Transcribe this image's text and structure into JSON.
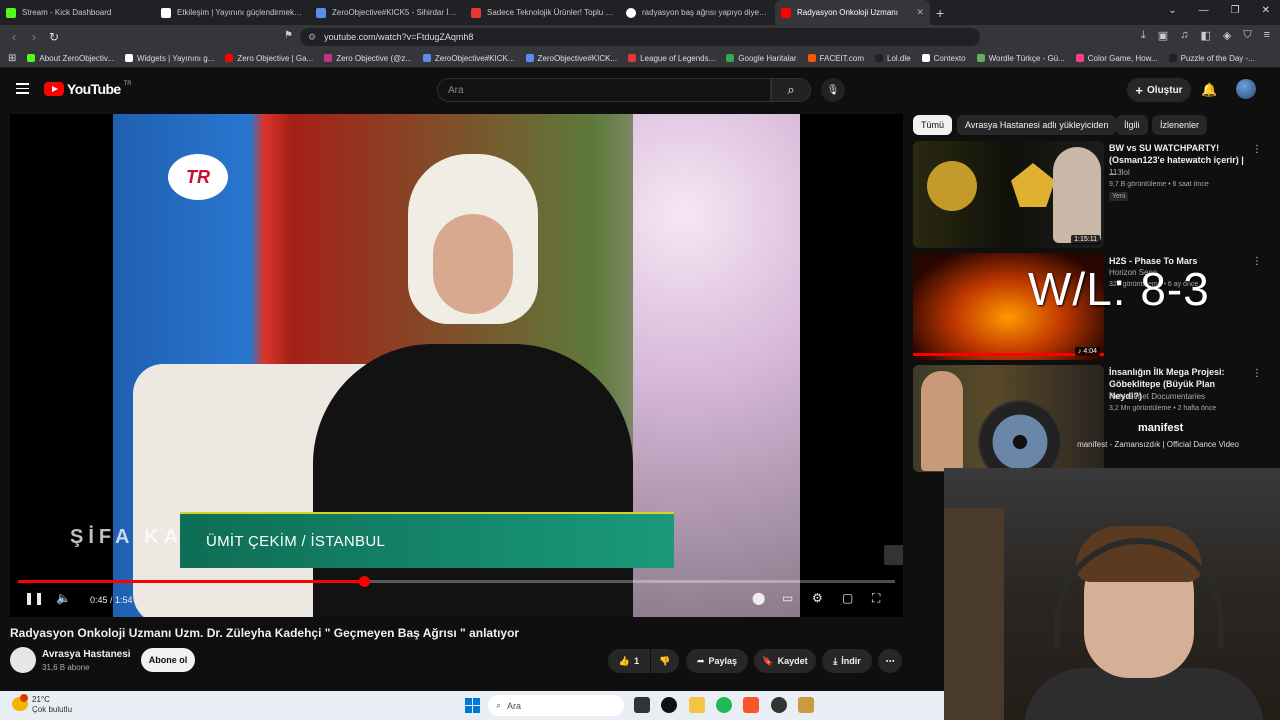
{
  "browser": {
    "tabs": [
      {
        "label": "Stream - Kick Dashboard",
        "color": "#53fc18"
      },
      {
        "label": "Etkileşim | Yayınını güçlendirmek için",
        "color": "#ffffff"
      },
      {
        "label": "ZeroObjective#KICK5 - Sihirdar İstatis",
        "color": "#5a8dee"
      },
      {
        "label": "Sadece Teknolojik Ürünler! Toplu Paket",
        "color": "#e53935"
      },
      {
        "label": "radyasyon baş ağrısı yapıyo diyen uz",
        "color": "#ffffff"
      },
      {
        "label": "Radyasyon Onkoloji Uzmanı",
        "color": "#ff0000"
      }
    ],
    "url": "youtube.com/watch?v=FtdugZAqmh8",
    "bookmarks": [
      {
        "label": "About ZeroObjectiv...",
        "color": "#53fc18"
      },
      {
        "label": "Widgets | Yayınını g...",
        "color": "#ffffff"
      },
      {
        "label": "Zero Objective | Ga...",
        "color": "#ff0000"
      },
      {
        "label": "Zero Objective (@z...",
        "color": "#c13584"
      },
      {
        "label": "ZeroObjective#KICK...",
        "color": "#5a8dee"
      },
      {
        "label": "ZeroObjective#KICK...",
        "color": "#5a8dee"
      },
      {
        "label": "League of Legends...",
        "color": "#e53935"
      },
      {
        "label": "Google Haritalar",
        "color": "#34a853"
      },
      {
        "label": "FACEIT.com",
        "color": "#ff5500"
      },
      {
        "label": "Lol.dle",
        "color": "#222222"
      },
      {
        "label": "Contexto",
        "color": "#ffffff"
      },
      {
        "label": "Wordle Türkçe - Gü...",
        "color": "#6aaa64"
      },
      {
        "label": "Color Game, How...",
        "color": "#ff4081"
      },
      {
        "label": "Puzzle of the Day -...",
        "color": "#222222"
      }
    ]
  },
  "youtube": {
    "logo": "YouTube",
    "country": "TR",
    "search_placeholder": "Ara",
    "create_label": "Oluştur"
  },
  "player": {
    "lower_third": "ÜMİT ÇEKİM / İSTANBUL",
    "brand": "ŞİFA KAPISI",
    "channel_logo": "TR",
    "current_time": "0:45",
    "duration": "1:54",
    "progress": 0.395,
    "time_display": "0:45 / 1:54"
  },
  "video": {
    "title": "Radyasyon Onkoloji Uzmanı Uzm. Dr. Züleyha Kadehçi \" Geçmeyen Baş Ağrısı \" anlatıyor",
    "channel": "Avrasya Hastanesi",
    "subscribers": "31,6 B abone",
    "subscribe_label": "Abone ol",
    "likes": "1",
    "share_label": "Paylaş",
    "save_label": "Kaydet",
    "download_label": "İndir"
  },
  "related": {
    "chips": [
      "Tümü",
      "Avrasya Hastanesi adlı yükleyiciden",
      "İlgili",
      "İzlenenler"
    ],
    "items": [
      {
        "title": "BW vs SU WATCHPARTY! (Osman123'e hatewatch içerir) | ...",
        "channel": "113lol",
        "meta": "9,7 B görüntüleme • 6 saat önce",
        "duration": "1:15:11",
        "badge": "Yeni"
      },
      {
        "title": "H2S - Phase To Mars",
        "channel": "Horizon Seco",
        "meta": "327 görüntüleme • 6 ay önce",
        "duration": "4:04"
      },
      {
        "title": "İnsanlığın İlk Mega Projesi: Göbeklitepe (Büyük Plan Neydi?)",
        "channel": "Ruhi Cenet Documentaries",
        "meta": "3,2 Mn görüntüleme • 2 hafta önce"
      }
    ]
  },
  "overlay": {
    "wl": "W/L: 8-3",
    "music_title": "manifest",
    "music_sub": "manifest - Zamansızdık | Official Dance Video"
  },
  "taskbar": {
    "temp": "21°C",
    "weather": "Çok bulutlu",
    "search": "Ara"
  }
}
